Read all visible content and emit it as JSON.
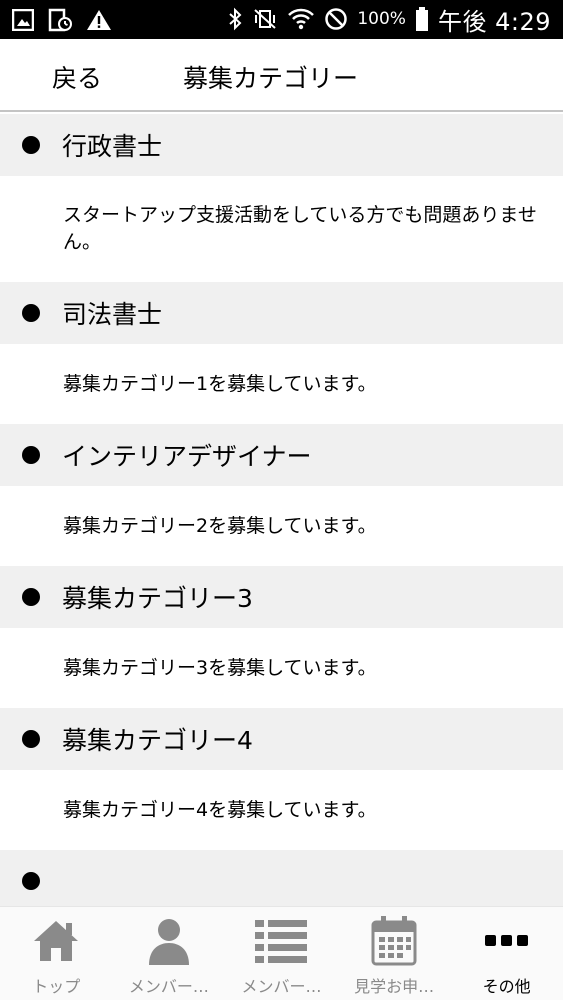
{
  "status_bar": {
    "battery_percent": "100%",
    "time": "午後 4:29"
  },
  "nav": {
    "back_label": "戻る",
    "title": "募集カテゴリー"
  },
  "categories": [
    {
      "title": "行政書士",
      "description": "スタートアップ支援活動をしている方でも問題ありません。"
    },
    {
      "title": "司法書士",
      "description": "募集カテゴリー1を募集しています。"
    },
    {
      "title": "インテリアデザイナー",
      "description": "募集カテゴリー2を募集しています。"
    },
    {
      "title": "募集カテゴリー3",
      "description": "募集カテゴリー3を募集しています。"
    },
    {
      "title": "募集カテゴリー4",
      "description": "募集カテゴリー4を募集しています。"
    },
    {
      "title": "",
      "description": ""
    }
  ],
  "tabs": [
    {
      "label": "トップ",
      "icon": "home-icon"
    },
    {
      "label": "メンバー…",
      "icon": "person-icon"
    },
    {
      "label": "メンバー…",
      "icon": "list-icon"
    },
    {
      "label": "見学お申…",
      "icon": "calendar-icon"
    },
    {
      "label": "その他",
      "icon": "more-icon",
      "active": true
    }
  ],
  "colors": {
    "tab_icon": "#8a8a8a",
    "tab_active": "#000000",
    "header_bg": "#f0f0f0"
  }
}
